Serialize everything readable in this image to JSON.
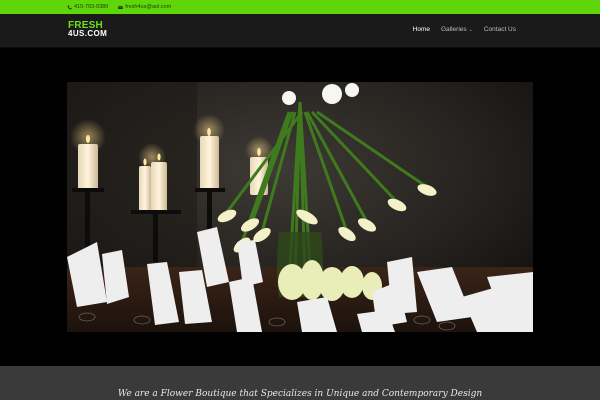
{
  "topbar": {
    "phone": "415-703-0380",
    "email": "fresh4us@aol.com",
    "phone_icon": "phone-icon",
    "email_icon": "envelope-icon",
    "color": "#5fd60a"
  },
  "logo": {
    "line1": "FRESH",
    "line2": "4US.COM",
    "color": "#6be01a"
  },
  "nav": {
    "items": [
      {
        "label": "Home",
        "active": true
      },
      {
        "label": "Galleries",
        "has_dropdown": true
      },
      {
        "label": "Contact Us"
      }
    ]
  },
  "hero": {
    "image": "candlelit table with calla lily centerpiece and folded napkins"
  },
  "tagline": "We are a Flower Boutique that Specializes in  Unique and Contemporary Design"
}
